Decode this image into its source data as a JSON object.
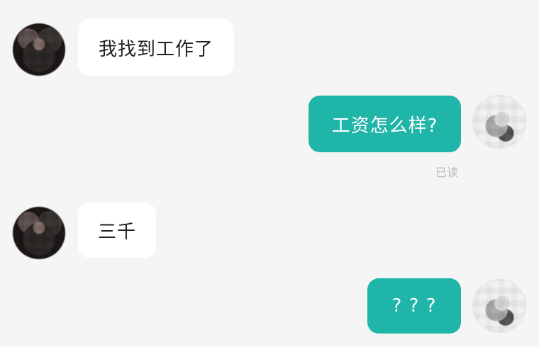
{
  "messages": [
    {
      "side": "left",
      "text": "我找到工作了"
    },
    {
      "side": "right",
      "text": "工资怎么样?",
      "status": "已读"
    },
    {
      "side": "left",
      "text": "三千"
    },
    {
      "side": "right",
      "text": "? ? ?"
    }
  ],
  "colors": {
    "background": "#f5f5f5",
    "incoming_bubble": "#ffffff",
    "outgoing_bubble": "#1fb5a8",
    "read_status": "#b8b8b8"
  }
}
